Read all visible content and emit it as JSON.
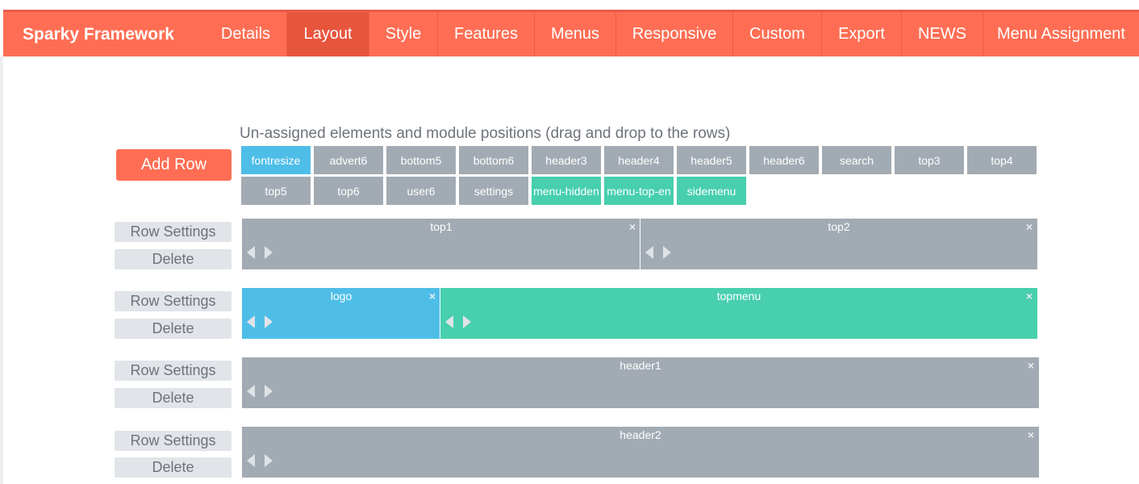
{
  "app": {
    "brand": "Sparky Framework"
  },
  "nav": {
    "items": [
      {
        "label": "Details"
      },
      {
        "label": "Layout"
      },
      {
        "label": "Style"
      },
      {
        "label": "Features"
      },
      {
        "label": "Menus"
      },
      {
        "label": "Responsive"
      },
      {
        "label": "Custom"
      },
      {
        "label": "Export"
      },
      {
        "label": "NEWS"
      },
      {
        "label": "Menu Assignment"
      }
    ],
    "active": "Layout"
  },
  "main": {
    "add_row_label": "Add Row",
    "unassigned_title": "Un-assigned elements and module positions (drag and drop to the rows)",
    "unassigned": [
      {
        "label": "fontresize",
        "color": "#4ebee8"
      },
      {
        "label": "advert6",
        "color": "#a2abb3"
      },
      {
        "label": "bottom5",
        "color": "#a2abb3"
      },
      {
        "label": "bottom6",
        "color": "#a2abb3"
      },
      {
        "label": "header3",
        "color": "#a2abb3"
      },
      {
        "label": "header4",
        "color": "#a2abb3"
      },
      {
        "label": "header5",
        "color": "#a2abb3"
      },
      {
        "label": "header6",
        "color": "#a2abb3"
      },
      {
        "label": "search",
        "color": "#a2abb3"
      },
      {
        "label": "top3",
        "color": "#a2abb3"
      },
      {
        "label": "top4",
        "color": "#a2abb3"
      },
      {
        "label": "top5",
        "color": "#a2abb3"
      },
      {
        "label": "top6",
        "color": "#a2abb3"
      },
      {
        "label": "user6",
        "color": "#a2abb3"
      },
      {
        "label": "settings",
        "color": "#a2abb3"
      },
      {
        "label": "menu-hidden",
        "color": "#47cfae"
      },
      {
        "label": "menu-top-en",
        "color": "#47cfae"
      },
      {
        "label": "sidemenu",
        "color": "#47cfae"
      }
    ],
    "row_settings_label": "Row Settings",
    "delete_label": "Delete",
    "rows": [
      {
        "cells": [
          {
            "name": "top1",
            "color": "#a2abb3"
          },
          {
            "name": "top2",
            "color": "#a2abb3"
          }
        ]
      },
      {
        "cells": [
          {
            "name": "logo",
            "color": "#4ebee8"
          },
          {
            "name": "topmenu",
            "color": "#47cfae"
          }
        ]
      },
      {
        "cells": [
          {
            "name": "header1",
            "color": "#a2abb3"
          }
        ]
      },
      {
        "cells": [
          {
            "name": "header2",
            "color": "#a2abb3"
          }
        ]
      }
    ],
    "close_icon": "×"
  },
  "colors": {
    "accent": "#ff6e54",
    "accent_active": "#e8553d",
    "grey_module": "#a2abb3",
    "blue_module": "#4ebee8",
    "green_module": "#47cfae"
  }
}
